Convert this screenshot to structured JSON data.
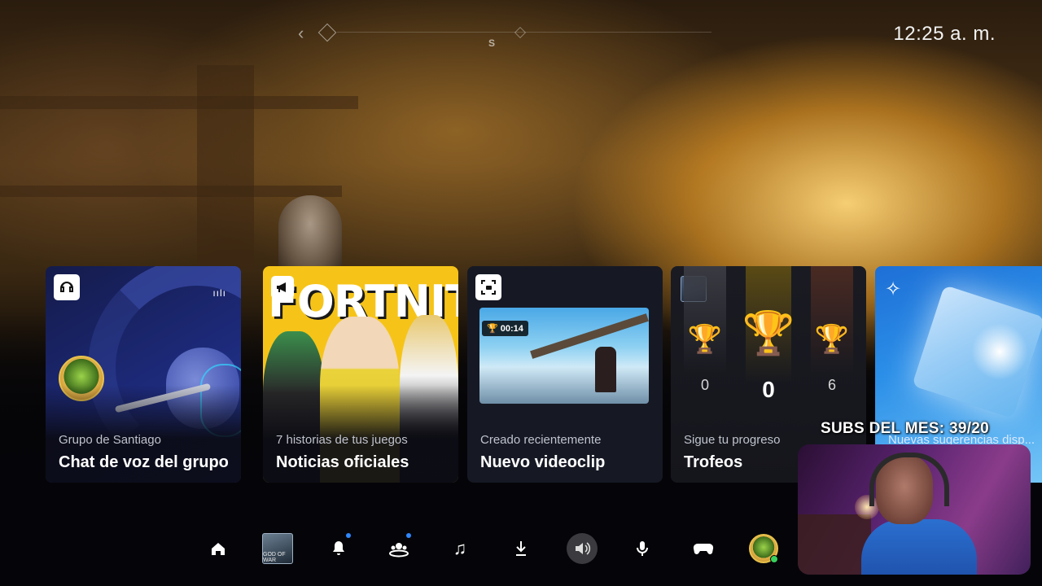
{
  "topbar": {
    "clock": "12:25 a. m.",
    "nav_letter": "S"
  },
  "cards": [
    {
      "id": "voice",
      "subtitle": "Grupo de Santiago",
      "title": "Chat de voz del grupo",
      "icon": "headset-icon"
    },
    {
      "id": "news",
      "subtitle": "7 historias de tus juegos",
      "title": "Noticias oficiales",
      "banner": "FORTNITE",
      "icon": "megaphone-icon"
    },
    {
      "id": "clip",
      "subtitle": "Creado recientemente",
      "title": "Nuevo videoclip",
      "duration": "00:14",
      "icon": "capture-icon"
    },
    {
      "id": "trophies",
      "subtitle": "Sigue tu progreso",
      "title": "Trofeos",
      "counts": {
        "silver": "0",
        "gold": "0",
        "bronze": "6"
      }
    },
    {
      "id": "suggestions",
      "subtitle": "Nuevas sugerencias disp..."
    }
  ],
  "overlay": {
    "subs": "SUBS DEL MES: 39/20"
  },
  "dock": {
    "items": [
      {
        "name": "home-icon"
      },
      {
        "name": "game-god-of-war-icon",
        "label": "GOD OF WAR"
      },
      {
        "name": "notifications-icon",
        "badge": true
      },
      {
        "name": "game-base-icon",
        "badge": true
      },
      {
        "name": "music-icon"
      },
      {
        "name": "downloads-icon"
      },
      {
        "name": "sound-icon",
        "active": true
      },
      {
        "name": "mic-icon"
      },
      {
        "name": "controller-icon"
      },
      {
        "name": "profile-avatar-icon"
      }
    ]
  },
  "colors": {
    "accent_blue": "#2f88ff",
    "gold": "#e6b422",
    "silver": "#c9ccd3",
    "bronze": "#c78262"
  }
}
